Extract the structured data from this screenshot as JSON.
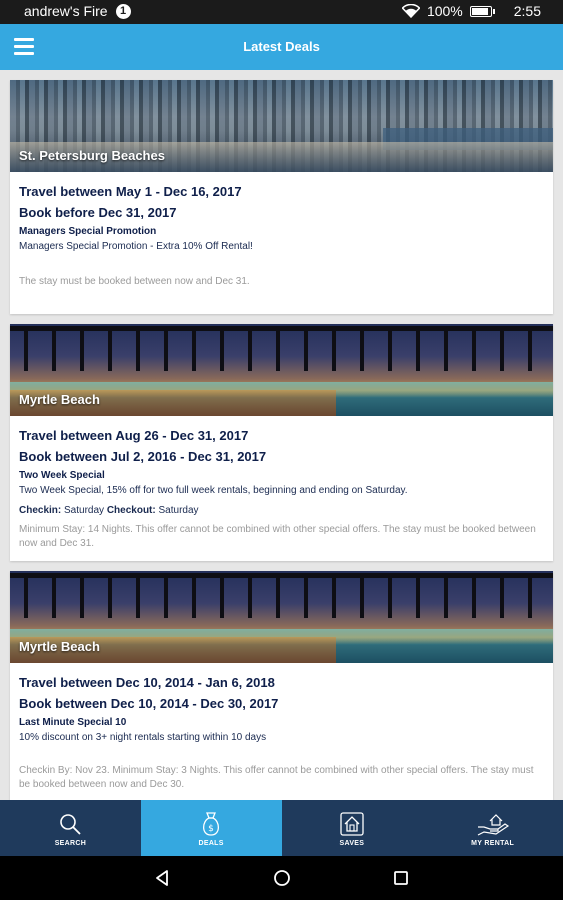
{
  "status_bar": {
    "carrier": "andrew's Fire",
    "notification_count": "1",
    "battery": "100%",
    "time": "2:55",
    "icons": [
      "wifi-icon",
      "battery-icon"
    ]
  },
  "app_bar": {
    "title": "Latest Deals",
    "menu_icon": "hamburger-menu-icon",
    "color": "#35a8e0"
  },
  "deals": [
    {
      "destination": "St. Petersburg Beaches",
      "travel": "Travel between May 1 - Dec 16, 2017",
      "book": "Book before Dec 31, 2017",
      "promo_title": "Managers Special Promotion",
      "promo_desc": "Managers Special Promotion - Extra 10% Off Rental!",
      "terms": "The stay must be booked between now and Dec 31."
    },
    {
      "destination": "Myrtle Beach",
      "travel": "Travel between Aug 26 - Dec 31, 2017",
      "book": "Book between Jul 2, 2016 - Dec 31, 2017",
      "promo_title": "Two Week Special",
      "promo_desc": "Two Week Special, 15% off for two full week rentals, beginning and ending on Saturday.",
      "checkin_label": "Checkin:",
      "checkin_value": "Saturday",
      "checkout_label": "Checkout:",
      "checkout_value": "Saturday",
      "terms": "Minimum Stay: 14 Nights. This offer cannot be combined with other special offers. The stay must be booked between now and Dec 31."
    },
    {
      "destination": "Myrtle Beach",
      "travel": "Travel between Dec 10, 2014 - Jan 6, 2018",
      "book": "Book between Dec 10, 2014 - Dec 30, 2017",
      "promo_title": "Last Minute Special 10",
      "promo_desc": "10% discount on 3+ night rentals starting within 10 days",
      "terms": "Checkin By: Nov 23. Minimum Stay: 3 Nights. This offer cannot be combined with other special offers. The stay must be booked between now and Dec 30."
    }
  ],
  "bottom_nav": {
    "active_tab": "DEALS",
    "active_color": "#35a8e0",
    "bar_color": "#1f3a5c",
    "tabs": [
      {
        "label": "SEARCH",
        "icon": "search-icon"
      },
      {
        "label": "DEALS",
        "icon": "money-bag-icon"
      },
      {
        "label": "SAVES",
        "icon": "saved-house-icon"
      },
      {
        "label": "MY RENTAL",
        "icon": "hand-house-icon"
      }
    ]
  },
  "system_nav": {
    "buttons": [
      "back-icon",
      "home-icon",
      "recents-icon"
    ]
  }
}
